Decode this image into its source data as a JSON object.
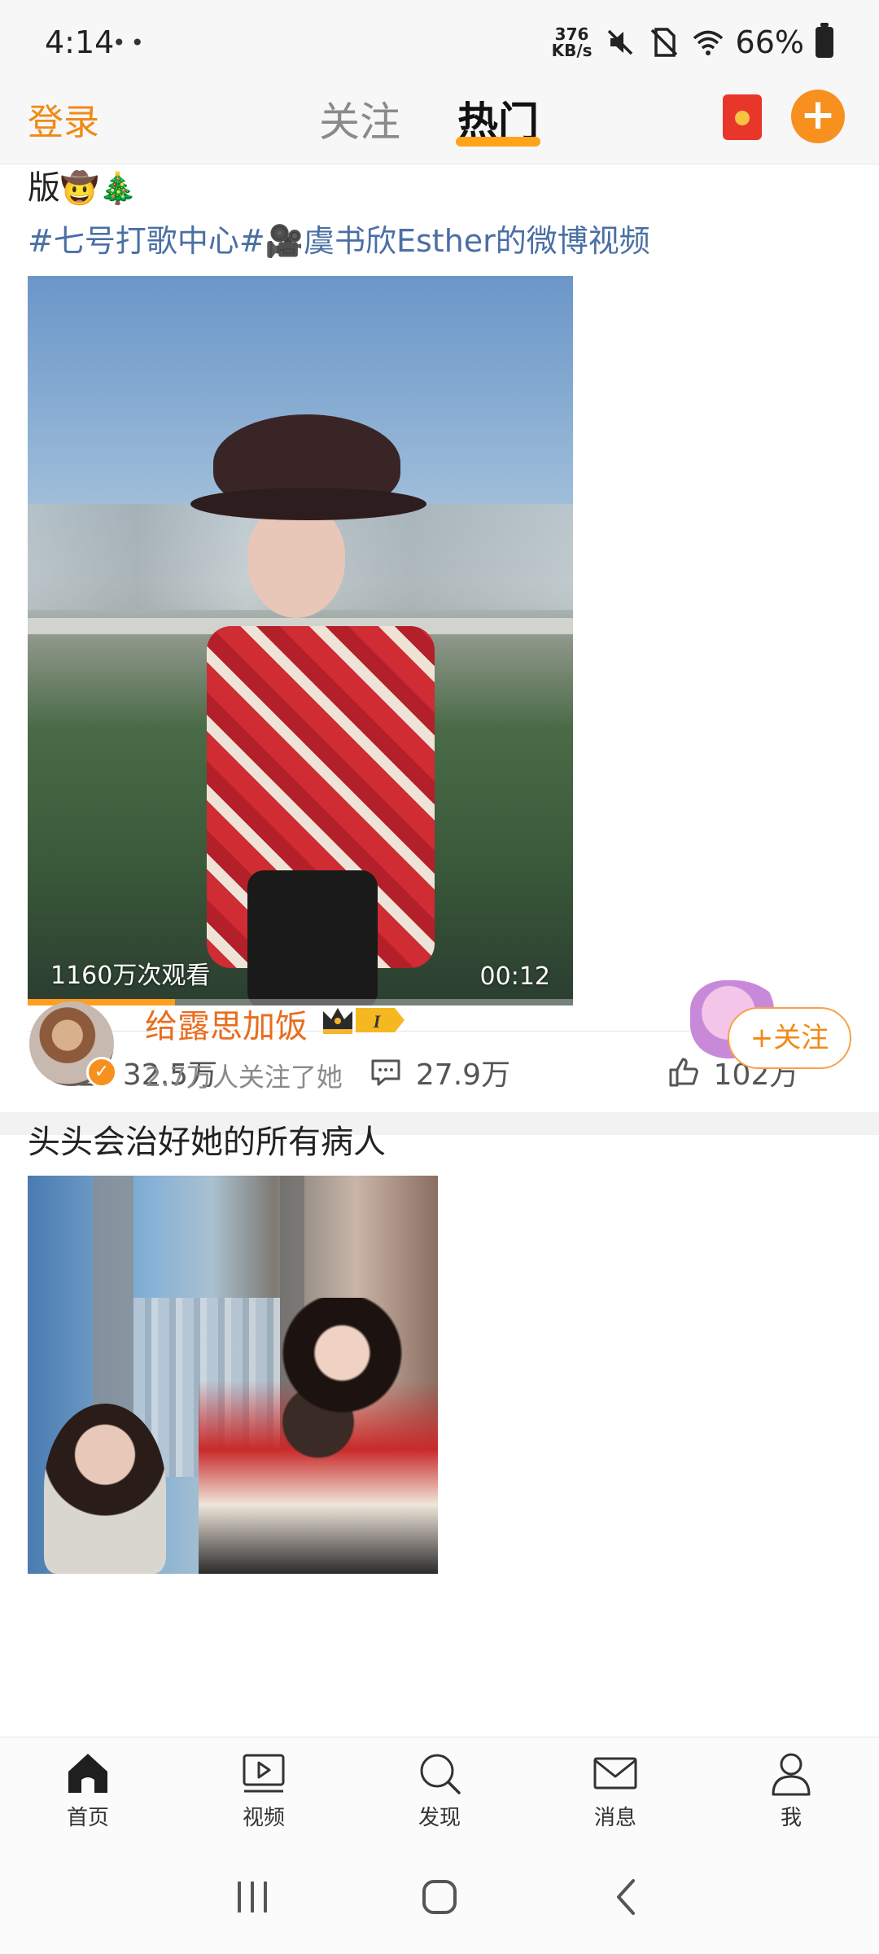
{
  "status_bar": {
    "time": "4:14",
    "left_icons": "••",
    "net_speed_value": "376",
    "net_speed_unit": "KB/s",
    "battery": "66%"
  },
  "top_nav": {
    "login": "登录",
    "tab_follow": "关注",
    "tab_hot": "热门",
    "plus": "+"
  },
  "post1": {
    "text_tail": "版",
    "emojis": "🤠🎄",
    "tags": "#七号打歌中心#🎥虞书欣Esther的微博视频",
    "video": {
      "views": "1160万次观看",
      "duration": "00:12",
      "progress_fraction": 0.27
    },
    "actions": {
      "repost": "32.5万",
      "comment": "27.9万",
      "like": "102万"
    }
  },
  "post2": {
    "username": "给露思加饭",
    "badge_level": "I",
    "followers": "2.7万人关注了她",
    "follow_button": "+关注",
    "text": "头头会治好她的所有病人"
  },
  "bottom_nav": [
    {
      "label": "首页"
    },
    {
      "label": "视频"
    },
    {
      "label": "发现"
    },
    {
      "label": "消息"
    },
    {
      "label": "我"
    }
  ],
  "colors": {
    "brand_orange": "#f7901e",
    "username_orange": "#e86d1f",
    "tag_blue": "#4a6fa5",
    "tab_indicator": "#ffa31a"
  }
}
